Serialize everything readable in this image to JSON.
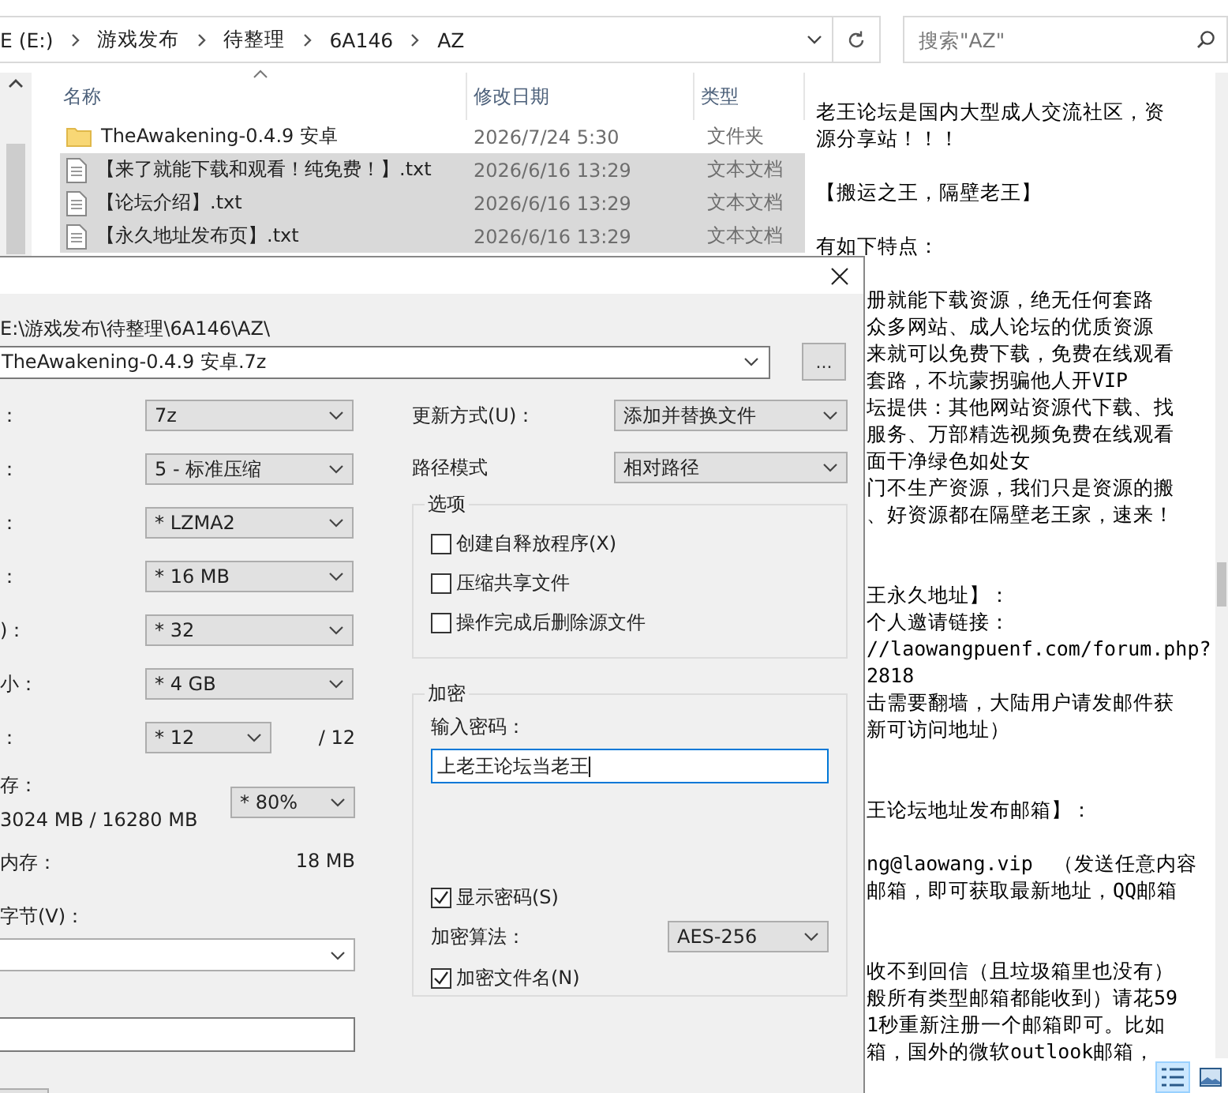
{
  "address_bar": {
    "crumbs": [
      "E (E:)",
      "游戏发布",
      "待整理",
      "6A146",
      "AZ"
    ]
  },
  "search": {
    "placeholder": "搜索\"AZ\""
  },
  "file_list": {
    "columns": [
      "名称",
      "修改日期",
      "类型"
    ],
    "rows": [
      {
        "kind": "folder",
        "name": "TheAwakening-0.4.9 安卓",
        "date": "2026/7/24 5:30",
        "type": "文件夹",
        "selected": false
      },
      {
        "kind": "text",
        "name": "【来了就能下载和观看！纯免费！】.txt",
        "date": "2026/6/16 13:29",
        "type": "文本文档",
        "selected": true
      },
      {
        "kind": "text",
        "name": "【论坛介绍】.txt",
        "date": "2026/6/16 13:29",
        "type": "文本文档",
        "selected": true
      },
      {
        "kind": "text",
        "name": "【永久地址发布页】.txt",
        "date": "2026/6/16 13:29",
        "type": "文本文档",
        "selected": true
      }
    ]
  },
  "preview": {
    "lines": [
      {
        "kind": "full",
        "text": "老王论坛是国内大型成人交流社区，资"
      },
      {
        "kind": "full",
        "text": "源分享站！！！"
      },
      {
        "kind": "blank"
      },
      {
        "kind": "full",
        "text": "【搬运之王，隔壁老王】"
      },
      {
        "kind": "blank"
      },
      {
        "kind": "full",
        "text": "有如下特点："
      },
      {
        "kind": "blank"
      },
      {
        "kind": "cut",
        "text": "册就能下载资源，绝无任何套路"
      },
      {
        "kind": "cut",
        "text": "众多网站、成人论坛的优质资源"
      },
      {
        "kind": "cut",
        "text": "来就可以免费下载，免费在线观看"
      },
      {
        "kind": "cut",
        "text": "套路，不坑蒙拐骗他人开VIP"
      },
      {
        "kind": "cut",
        "text": "坛提供：其他网站资源代下载、找"
      },
      {
        "kind": "cut",
        "text": "服务、万部精选视频免费在线观看"
      },
      {
        "kind": "cut",
        "text": "面干净绿色如处女"
      },
      {
        "kind": "cut",
        "text": "门不生产资源，我们只是资源的搬"
      },
      {
        "kind": "cut",
        "text": "、好资源都在隔壁老王家，速来！"
      },
      {
        "kind": "blank"
      },
      {
        "kind": "blank"
      },
      {
        "kind": "cut",
        "text": "王永久地址】："
      },
      {
        "kind": "cut",
        "text": "个人邀请链接："
      },
      {
        "kind": "cut",
        "text": "//laowangpuenf.com/forum.php?"
      },
      {
        "kind": "cut",
        "text": "2818"
      },
      {
        "kind": "cut",
        "text": "击需要翻墙，大陆用户请发邮件获"
      },
      {
        "kind": "cut",
        "text": "新可访问地址）"
      },
      {
        "kind": "blank"
      },
      {
        "kind": "blank"
      },
      {
        "kind": "cut",
        "text": "王论坛地址发布邮箱】："
      },
      {
        "kind": "blank"
      },
      {
        "kind": "cut",
        "text": "ng@laowang.vip　（发送任意内容"
      },
      {
        "kind": "cut",
        "text": "邮箱，即可获取最新地址，QQ邮箱"
      },
      {
        "kind": "blank"
      },
      {
        "kind": "blank"
      },
      {
        "kind": "cut",
        "text": "收不到回信（且垃圾箱里也没有）"
      },
      {
        "kind": "cut",
        "text": "般所有类型邮箱都能收到）请花59"
      },
      {
        "kind": "cut",
        "text": "1秒重新注册一个邮箱即可。比如"
      },
      {
        "kind": "cut",
        "text": "箱，国外的微软outlook邮箱，"
      }
    ]
  },
  "dialog": {
    "path": "E:\\游戏发布\\待整理\\6A146\\AZ\\",
    "archive_name": "TheAwakening-0.4.9 安卓.7z",
    "browse": "...",
    "settings": [
      {
        "kind": "combo",
        "label": "：",
        "value": "7z"
      },
      {
        "kind": "combo",
        "label": "：",
        "value": "5 - 标准压缩"
      },
      {
        "kind": "combo",
        "label": "：",
        "value": "* LZMA2"
      },
      {
        "kind": "combo",
        "label": "：",
        "value": "* 16 MB"
      },
      {
        "kind": "combo",
        "label": ")：",
        "value": "* 32"
      },
      {
        "kind": "combo",
        "label": "小：",
        "value": "* 4 GB"
      },
      {
        "kind": "combo_total",
        "label": "：",
        "value": "* 12",
        "total": "/ 12"
      }
    ],
    "memory": {
      "label": "存：",
      "value": "3024 MB / 16280 MB",
      "percent": "* 80%"
    },
    "decompress": {
      "label": "内存：",
      "value": "18 MB"
    },
    "params_label": "字节(V)：",
    "update": {
      "label": "更新方式(U)：",
      "value": "添加并替换文件"
    },
    "path_mode": {
      "label": "路径模式",
      "value": "相对路径"
    },
    "options": {
      "title": "选项",
      "items": [
        {
          "label": "创建自释放程序(X)",
          "checked": false
        },
        {
          "label": "压缩共享文件",
          "checked": false
        },
        {
          "label": "操作完成后删除源文件",
          "checked": false
        }
      ]
    },
    "encryption": {
      "title": "加密",
      "password_label": "输入密码：",
      "password": "上老王论坛当老王",
      "show_password": {
        "label": "显示密码(S)",
        "checked": true
      },
      "method_label": "加密算法：",
      "method": "AES-256",
      "encrypt_names": {
        "label": "加密文件名(N)",
        "checked": true
      }
    }
  }
}
